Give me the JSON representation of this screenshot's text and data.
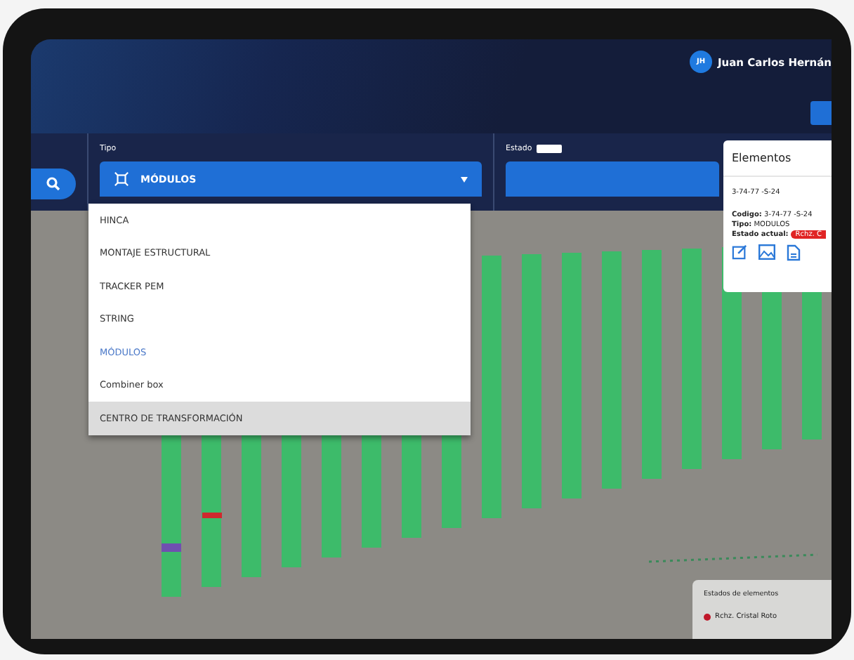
{
  "header": {
    "avatar": "JH",
    "user_name": "Juan Carlos Hernán"
  },
  "filters": [
    {
      "label": "Tipo",
      "value": "MÓDULOS"
    },
    {
      "label": "Estado"
    }
  ],
  "dropdown": {
    "items": [
      {
        "label": "HINCA",
        "selected": false,
        "highlighted": false
      },
      {
        "label": "MONTAJE ESTRUCTURAL",
        "selected": false,
        "highlighted": false
      },
      {
        "label": "TRACKER PEM",
        "selected": false,
        "highlighted": false
      },
      {
        "label": "STRING",
        "selected": false,
        "highlighted": false
      },
      {
        "label": "MÓDULOS",
        "selected": true,
        "highlighted": false
      },
      {
        "label": "Combiner box",
        "selected": false,
        "highlighted": false
      },
      {
        "label": "CENTRO DE TRANSFORMACIÓN",
        "selected": false,
        "highlighted": true
      }
    ]
  },
  "elements_panel": {
    "title": "Elementos",
    "element_id": "3-74-77 -S-24",
    "code_label": "Codigo:",
    "code": "3-74-77 -S-24",
    "type_label": "Tipo:",
    "type": "MODULOS",
    "status_label": "Estado actual:",
    "status": "Rchz. C"
  },
  "legend": {
    "title": "Estados de elementos",
    "items": [
      {
        "label": "Rchz. Cristal Roto",
        "color": "#c0182a"
      }
    ]
  }
}
